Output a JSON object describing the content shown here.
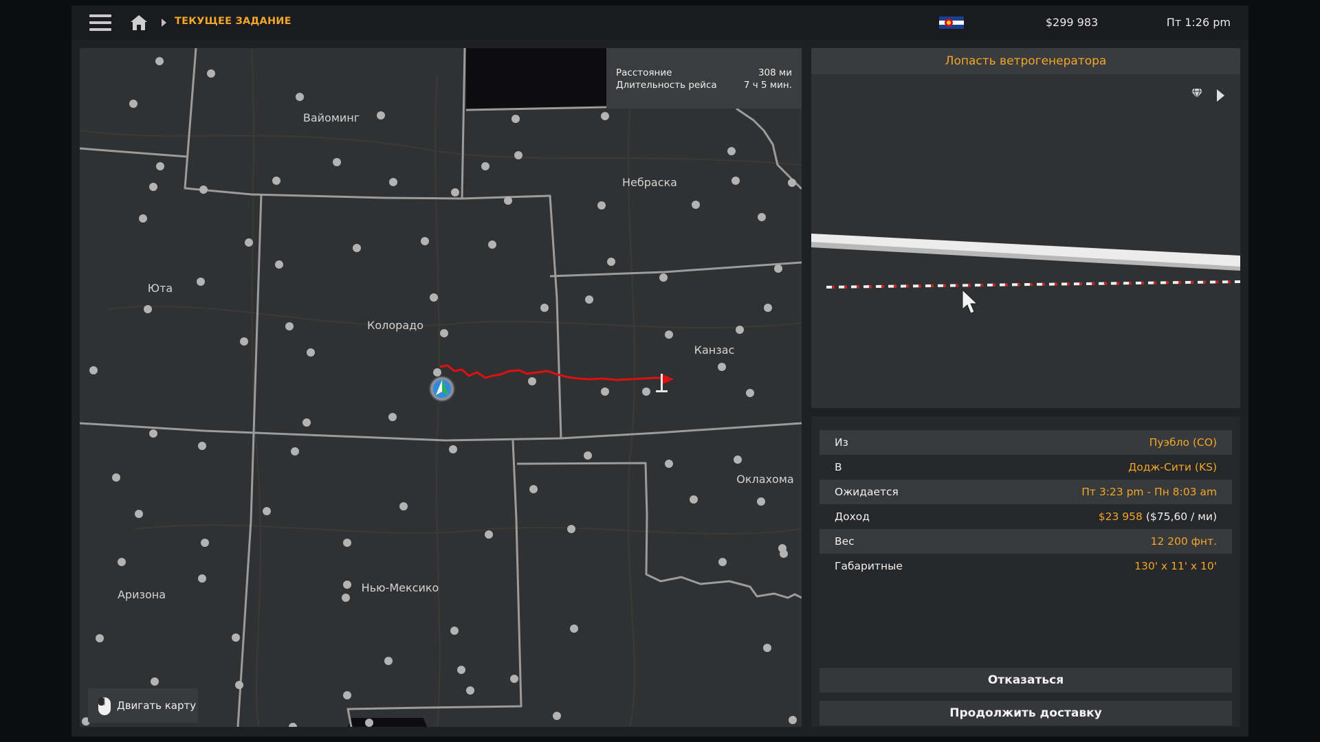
{
  "topbar": {
    "breadcrumb": "ТЕКУЩЕЕ ЗАДАНИЕ",
    "money": "$299 983",
    "time": "Пт 1:26 pm",
    "icons": [
      "menu-icon",
      "home-icon",
      "chevron-right-icon",
      "colorado-flag-icon"
    ]
  },
  "map": {
    "states": {
      "wyoming": "Вайоминг",
      "nebraska": "Небраска",
      "utah": "Юта",
      "colorado": "Колорадо",
      "kansas": "Канзас",
      "oklahoma": "Оклахома",
      "arizona": "Аризона",
      "new_mexico": "Нью-Мексико"
    },
    "route_info": {
      "distance_label": "Расстояние",
      "distance_value": "308 ми",
      "duration_label": "Длительность рейса",
      "duration_value": "7 ч 5 мин."
    },
    "move_map_label": "Двигать карту",
    "route_color": "#e01010"
  },
  "cargo": {
    "title": "Лопасть ветрогенератора"
  },
  "details": {
    "from_label": "Из",
    "from_value": "Пуэбло (CO)",
    "to_label": "В",
    "to_value": "Додж-Сити (KS)",
    "expected_label": "Ожидается",
    "expected_value": "Пт 3:23 pm - Пн 8:03 am",
    "income_label": "Доход",
    "income_value": "$23 958",
    "income_rate": "($75,60 / ми)",
    "weight_label": "Вес",
    "weight_value": "12 200 фнт.",
    "dimensions_label": "Габаритные",
    "dimensions_value": "130' x 11' x 10'"
  },
  "buttons": {
    "decline": "Отказаться",
    "continue": "Продолжить доставку"
  },
  "colors": {
    "accent": "#f2a62a",
    "panel": "#303133",
    "background": "#1f2023"
  }
}
